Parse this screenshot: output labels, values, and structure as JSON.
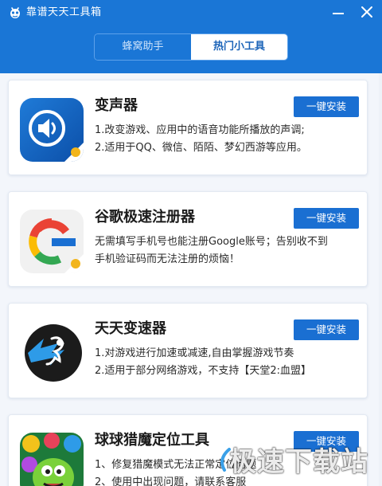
{
  "app": {
    "title": "靠谱天天工具箱",
    "accent_color": "#1a76d6",
    "logo_icon": "bee-logo-icon"
  },
  "window_controls": {
    "minimize_icon": "minimize-icon",
    "close_icon": "close-icon"
  },
  "tabs": [
    {
      "label": "蜂窝助手",
      "active": false
    },
    {
      "label": "热门小工具",
      "active": true
    }
  ],
  "tools": [
    {
      "name": "变声器",
      "icon": "voice-changer-icon",
      "button": "一键安装",
      "lines": [
        "1.改变游戏、应用中的语音功能所播放的声调;",
        "2.适用于QQ、微信、陌陌、梦幻西游等应用。"
      ]
    },
    {
      "name": "谷歌极速注册器",
      "icon": "google-register-icon",
      "button": "一键安装",
      "lines": [
        "无需填写手机号也能注册Google账号；告别收不到",
        "手机验证码而无法注册的烦恼！"
      ]
    },
    {
      "name": "天天变速器",
      "icon": "speed-changer-icon",
      "button": "一键安装",
      "lines": [
        "1.对游戏进行加速或减速,自由掌握游戏节奏",
        "2.适用于部分网络游戏，不支持【天堂2:血盟】"
      ]
    },
    {
      "name": "球球猎魔定位工具",
      "icon": "monster-locator-icon",
      "button": "一键安装",
      "lines": [
        "1、修复猎魔模式无法正常定位问题",
        "2、使用中出现问题，请联系客服"
      ]
    }
  ],
  "watermark": {
    "text": "极速下载站"
  }
}
